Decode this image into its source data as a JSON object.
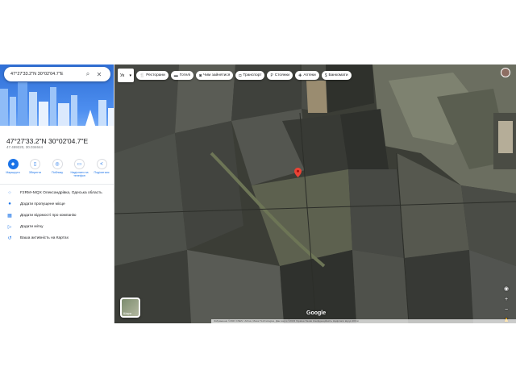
{
  "sidebar": {
    "search": {
      "value": "47°27'33.2\"N 30°02'04.7\"E",
      "search_icon": "search-icon",
      "close_icon": "close-icon"
    },
    "place": {
      "title": "47°27'33.2\"N 30°02'04.7\"E",
      "decimal_coords": "47.459220, 30.034644"
    },
    "actions": [
      {
        "label": "Маршрути",
        "icon": "directions-icon"
      },
      {
        "label": "Зберегти",
        "icon": "bookmark-icon"
      },
      {
        "label": "Поблизу",
        "icon": "nearby-icon"
      },
      {
        "label": "Надіслати на телефон",
        "icon": "phone-icon"
      },
      {
        "label": "Поділитися",
        "icon": "share-icon"
      }
    ],
    "info_rows": [
      {
        "text": "F2RM+MQX Олександрівка, Одеська область",
        "icon": "plus-code-icon"
      },
      {
        "text": "Додати пропущене місце",
        "icon": "add-place-icon"
      },
      {
        "text": "Додати відомості про компанію",
        "icon": "business-icon"
      },
      {
        "text": "Додати мітку",
        "icon": "label-icon"
      },
      {
        "text": "Ваша активність на Картах",
        "icon": "history-icon"
      }
    ]
  },
  "map": {
    "language_selector": "Ук",
    "chips": [
      {
        "label": "Ресторани",
        "icon": "restaurant-icon"
      },
      {
        "label": "Готелі",
        "icon": "hotel-icon"
      },
      {
        "label": "Чим зайнятися",
        "icon": "camera-icon"
      },
      {
        "label": "Транспорт",
        "icon": "transit-icon"
      },
      {
        "label": "Стоянки",
        "icon": "parking-icon"
      },
      {
        "label": "Аптеки",
        "icon": "pharmacy-icon"
      },
      {
        "label": "Банкомати",
        "icon": "atm-icon"
      }
    ],
    "layers_label": "Шари",
    "logo": "Google",
    "attribution": "Зображення ©2023 CNES / Airbus, Maxar Technologies, Дані карти ©2023   Україна   Умови   Конфіденційність   Надіслати відгук   200 м",
    "colors": {
      "pin": "#ea4335",
      "accent": "#1a73e8"
    }
  }
}
